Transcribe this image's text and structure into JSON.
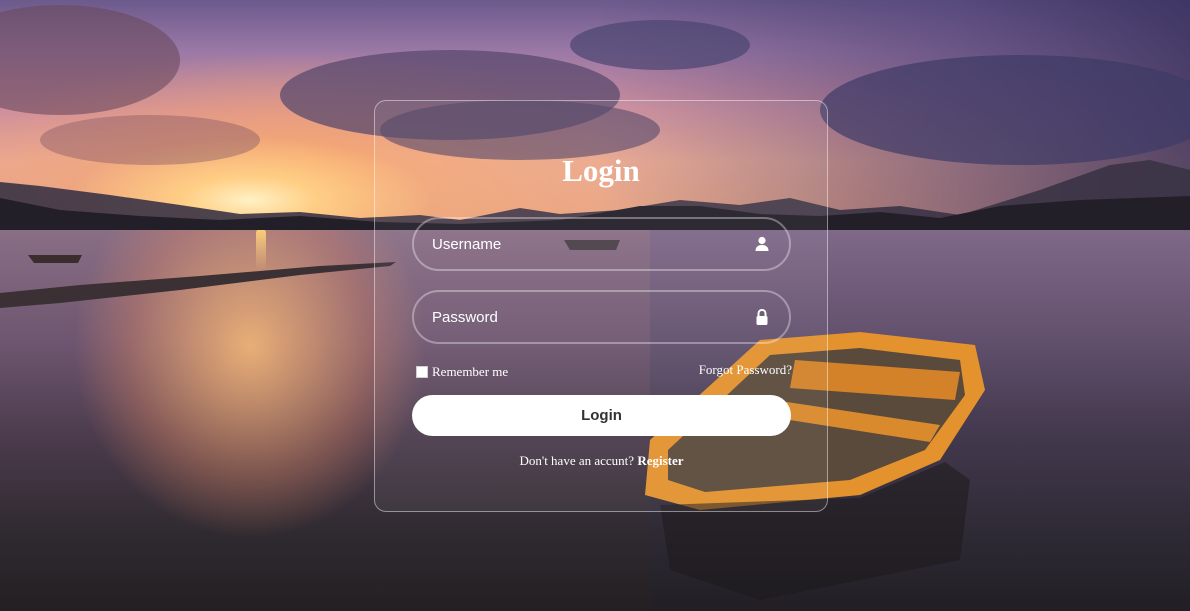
{
  "login": {
    "title": "Login",
    "username_placeholder": "Username",
    "password_placeholder": "Password",
    "remember_label": "Remember me",
    "remember_checked": false,
    "forgot_label": "Forgot Password?",
    "submit_label": "Login",
    "register_prompt": "Don't have an accunt?",
    "register_link": "Register"
  },
  "icons": {
    "username": "user-icon",
    "password": "lock-icon"
  },
  "colors": {
    "text": "#ffffff",
    "button_bg": "#ffffff",
    "button_text": "#333333"
  }
}
